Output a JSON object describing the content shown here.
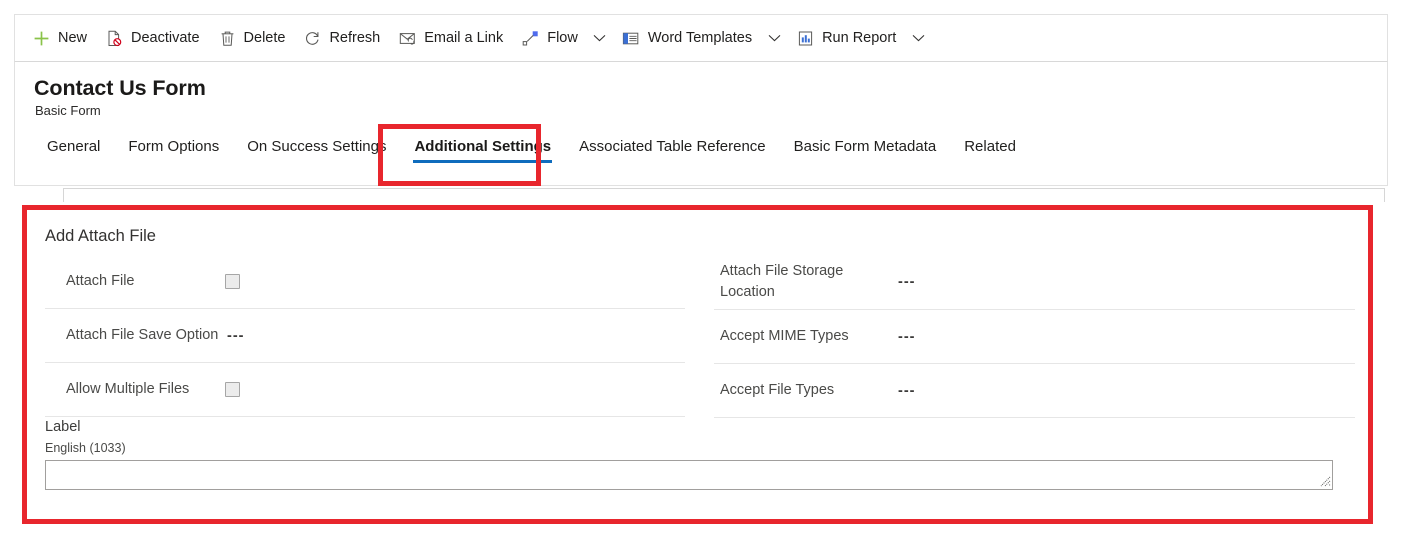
{
  "commandbar": {
    "items": [
      {
        "label": "New",
        "icon": "plus-icon",
        "caret": false
      },
      {
        "label": "Deactivate",
        "icon": "deactivate-icon",
        "caret": false
      },
      {
        "label": "Delete",
        "icon": "trash-icon",
        "caret": false
      },
      {
        "label": "Refresh",
        "icon": "refresh-icon",
        "caret": false
      },
      {
        "label": "Email a Link",
        "icon": "email-link-icon",
        "caret": false
      },
      {
        "label": "Flow",
        "icon": "flow-icon",
        "caret": true
      },
      {
        "label": "Word Templates",
        "icon": "word-template-icon",
        "caret": true
      },
      {
        "label": "Run Report",
        "icon": "run-report-icon",
        "caret": true
      }
    ]
  },
  "header": {
    "title": "Contact Us Form",
    "subtitle": "Basic Form"
  },
  "tabs": {
    "items": [
      {
        "label": "General"
      },
      {
        "label": "Form Options"
      },
      {
        "label": "On Success Settings"
      },
      {
        "label": "Additional Settings"
      },
      {
        "label": "Associated Table Reference"
      },
      {
        "label": "Basic Form Metadata"
      },
      {
        "label": "Related"
      }
    ],
    "active_index": 3
  },
  "form": {
    "section_title": "Add Attach File",
    "left_fields": [
      {
        "label": "Attach File",
        "type": "checkbox",
        "value": "",
        "checked": false
      },
      {
        "label": "Attach File Save Option",
        "type": "text",
        "value": "---"
      },
      {
        "label": "Allow Multiple Files",
        "type": "checkbox",
        "value": "",
        "checked": false
      }
    ],
    "right_fields": [
      {
        "label": "Attach File Storage Location",
        "type": "text",
        "value": "---"
      },
      {
        "label": "Accept MIME Types",
        "type": "text",
        "value": "---"
      },
      {
        "label": "Accept File Types",
        "type": "text",
        "value": "---"
      }
    ],
    "label_block": {
      "title": "Label",
      "language": "English (1033)",
      "value": "",
      "placeholder": ""
    }
  },
  "annotations": {
    "highlight_color": "#e8262d",
    "boxes": [
      {
        "name": "additional-settings-tab-highlight"
      },
      {
        "name": "add-attach-file-section-highlight"
      }
    ]
  },
  "colors": {
    "accent": "#0f6cbd",
    "new_icon": "#6bb700",
    "text": "#201f1e",
    "divider": "#e6e6e6"
  }
}
